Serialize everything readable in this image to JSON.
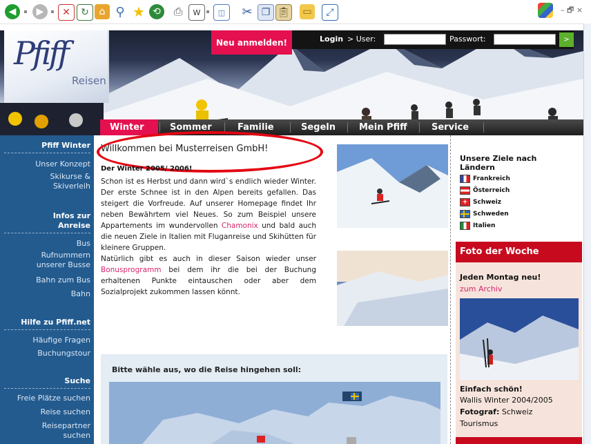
{
  "browser": {
    "toolbar_buttons": [
      "back-icon",
      "forward-icon",
      "stop-icon",
      "refresh-icon",
      "home-icon",
      "search-icon",
      "favorites-icon",
      "history-icon",
      "print-icon",
      "word-icon",
      "preview-icon",
      "cut-icon",
      "copy-icon",
      "paste-icon",
      "folder-icon",
      "fullscreen-icon"
    ],
    "window_controls": "– 🗗 ×"
  },
  "header": {
    "logo_brand": "Pfiff",
    "logo_sub": "Reisen",
    "register_button": "Neu anmelden!",
    "login_label": "Login",
    "user_label": "> User:",
    "password_label": "Passwort:",
    "go_button": ">"
  },
  "nav": {
    "items": [
      "Winter",
      "Sommer",
      "Familie",
      "Segeln",
      "Mein Pfiff",
      "Service"
    ],
    "active": "Winter"
  },
  "sidebar": {
    "sections": [
      {
        "heading": "Pfiff Winter",
        "items": [
          "Unser Konzept",
          "Skikurse &",
          "Skiverleih"
        ]
      },
      {
        "heading": "Infos zur",
        "heading2": "Anreise",
        "items": [
          "Bus",
          "Rufnummern",
          "unserer Busse",
          "Bahn zum Bus",
          "Bahn"
        ]
      },
      {
        "heading": "Hilfe zu Pfiff.net",
        "items": [
          "Häufige Fragen",
          "Buchungstour"
        ]
      },
      {
        "heading": "Suche",
        "items": [
          "Freie Plätze suchen",
          "Reise suchen",
          "Reisepartner",
          "suchen"
        ]
      }
    ]
  },
  "main": {
    "title": "Willkommen bei Musterreisen GmbH!",
    "subtitle": "Der Winter 2005/ 2006!",
    "paragraph_1a": "Schon ist es Herbst und dann wird`s endlich wieder Winter. Der erste Schnee ist in den Alpen bereits gefallen. Das steigert die Vorfreude. Auf unserer Homepage findet Ihr neben Bewährtem viel Neues. So zum Beispiel unsere Appartements im wundervollen ",
    "link_chamonix": "Chamonix",
    "paragraph_1b": " und bald auch die neuen Ziele in Italien mit Fluganreise und Skihütten für kleinere Gruppen.",
    "paragraph_2a": "Natürlich gibt es auch in dieser Saison wieder unser ",
    "link_bonus": "Bonusprogramm",
    "paragraph_2b": " bei dem ihr die bei der Buchung erhaltenen Punkte eintauschen oder aber dem Sozialprojekt zukommen lassen könnt.",
    "chooser_title": "Bitte wähle aus, wo die Reise hingehen soll:"
  },
  "right": {
    "title": "Unsere Ziele nach Ländern",
    "countries": [
      "Frankreich",
      "Österreich",
      "Schweiz",
      "Schweden",
      "Italien"
    ],
    "foto_heading": "Foto der Woche",
    "foto_bold": "Jeden Montag neu!",
    "foto_link": "zum Archiv",
    "caption_bold": "Einfach schön!",
    "caption_line": "Wallis Winter 2004/2005",
    "photographer_label": "Fotograf:",
    "photographer_value": " Schweiz",
    "photographer_value2": "Tourismus"
  }
}
